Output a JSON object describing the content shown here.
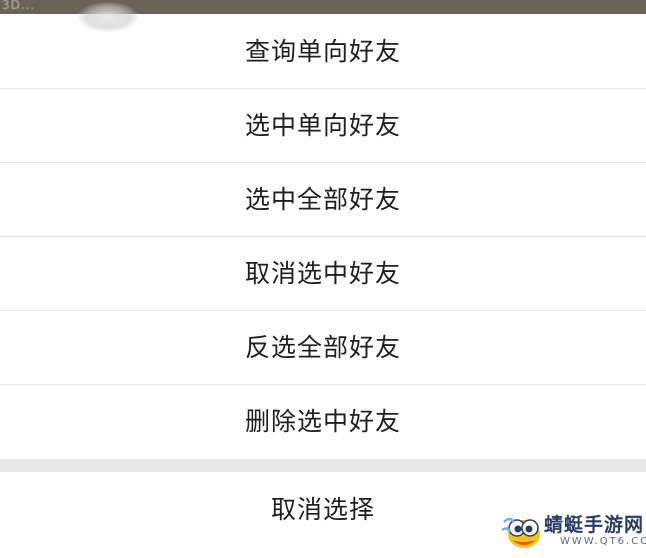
{
  "backdrop": {
    "text": "3D..."
  },
  "action_sheet": {
    "items": [
      {
        "label": "查询单向好友"
      },
      {
        "label": "选中单向好友"
      },
      {
        "label": "选中全部好友"
      },
      {
        "label": "取消选中好友"
      },
      {
        "label": "反选全部好友"
      },
      {
        "label": "删除选中好友"
      }
    ],
    "cancel_label": "取消选择"
  },
  "watermark": {
    "title": "蜻蜓手游网",
    "url": "WWW.QT6.COM"
  },
  "colors": {
    "text": "#1f1f1f",
    "divider": "#e6e6e6",
    "gap": "#e8e8e8",
    "backdrop": "#6b6257",
    "watermark_title": "#2a3b6a"
  }
}
